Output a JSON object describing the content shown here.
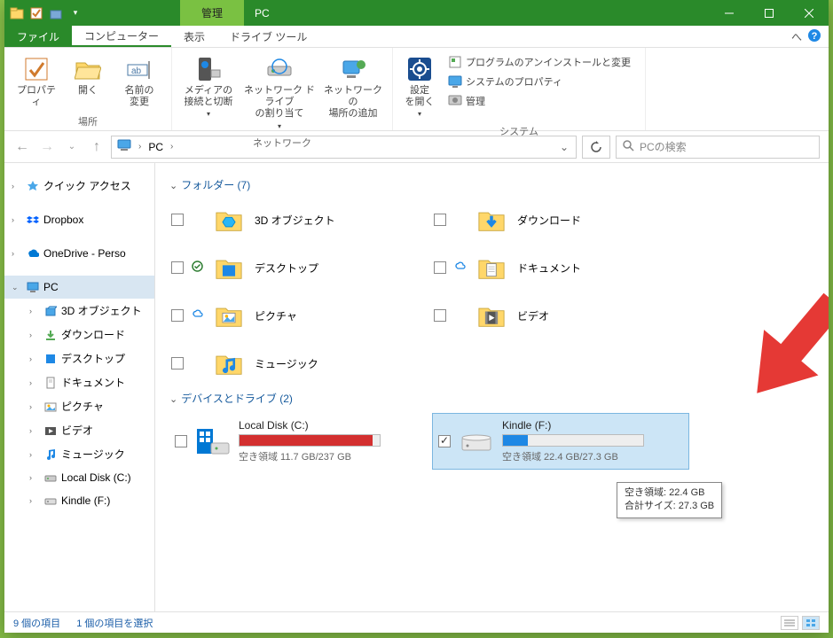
{
  "titlebar": {
    "context_tab": "管理",
    "title": "PC"
  },
  "ribbon_tabs": {
    "file": "ファイル",
    "computer": "コンピューター",
    "view": "表示",
    "drive_tools": "ドライブ ツール"
  },
  "ribbon": {
    "location": {
      "properties": "プロパティ",
      "open": "開く",
      "rename": "名前の\n変更",
      "group": "場所"
    },
    "network": {
      "media": "メディアの\n接続と切断",
      "map_drive": "ネットワーク ドライブ\nの割り当て",
      "add_location": "ネットワークの\n場所の追加",
      "group": "ネットワーク"
    },
    "system": {
      "settings": "設定\nを開く",
      "uninstall": "プログラムのアンインストールと変更",
      "sys_props": "システムのプロパティ",
      "manage": "管理",
      "group": "システム"
    }
  },
  "addressbar": {
    "location": "PC"
  },
  "search": {
    "placeholder": "PCの検索"
  },
  "navpane": {
    "quick_access": "クイック アクセス",
    "dropbox": "Dropbox",
    "onedrive": "OneDrive - Perso",
    "pc": "PC",
    "items": [
      {
        "label": "3D オブジェクト",
        "icon": "3d"
      },
      {
        "label": "ダウンロード",
        "icon": "download"
      },
      {
        "label": "デスクトップ",
        "icon": "desktop"
      },
      {
        "label": "ドキュメント",
        "icon": "document"
      },
      {
        "label": "ピクチャ",
        "icon": "pictures"
      },
      {
        "label": "ビデオ",
        "icon": "video"
      },
      {
        "label": "ミュージック",
        "icon": "music"
      },
      {
        "label": "Local Disk (C:)",
        "icon": "disk"
      },
      {
        "label": "Kindle (F:)",
        "icon": "drive"
      }
    ]
  },
  "content": {
    "folders_header": "フォルダー (7)",
    "folders": [
      {
        "label": "3D オブジェクト",
        "status": ""
      },
      {
        "label": "ダウンロード",
        "status": ""
      },
      {
        "label": "デスクトップ",
        "status": "synced"
      },
      {
        "label": "ドキュメント",
        "status": "cloud"
      },
      {
        "label": "ピクチャ",
        "status": "cloud"
      },
      {
        "label": "ビデオ",
        "status": ""
      },
      {
        "label": "ミュージック",
        "status": ""
      }
    ],
    "drives_header": "デバイスとドライブ (2)",
    "drives": [
      {
        "name": "Local Disk (C:)",
        "free_text": "空き領域 11.7 GB/237 GB",
        "fill_pct": 95,
        "fill_color": "#d32f2f",
        "selected": false
      },
      {
        "name": "Kindle (F:)",
        "free_text": "空き領域 22.4 GB/27.3 GB",
        "fill_pct": 18,
        "fill_color": "#1e88e5",
        "selected": true
      }
    ],
    "tooltip": {
      "line1": "空き領域: 22.4 GB",
      "line2": "合計サイズ: 27.3 GB"
    }
  },
  "statusbar": {
    "count": "9 個の項目",
    "selection": "1 個の項目を選択"
  }
}
